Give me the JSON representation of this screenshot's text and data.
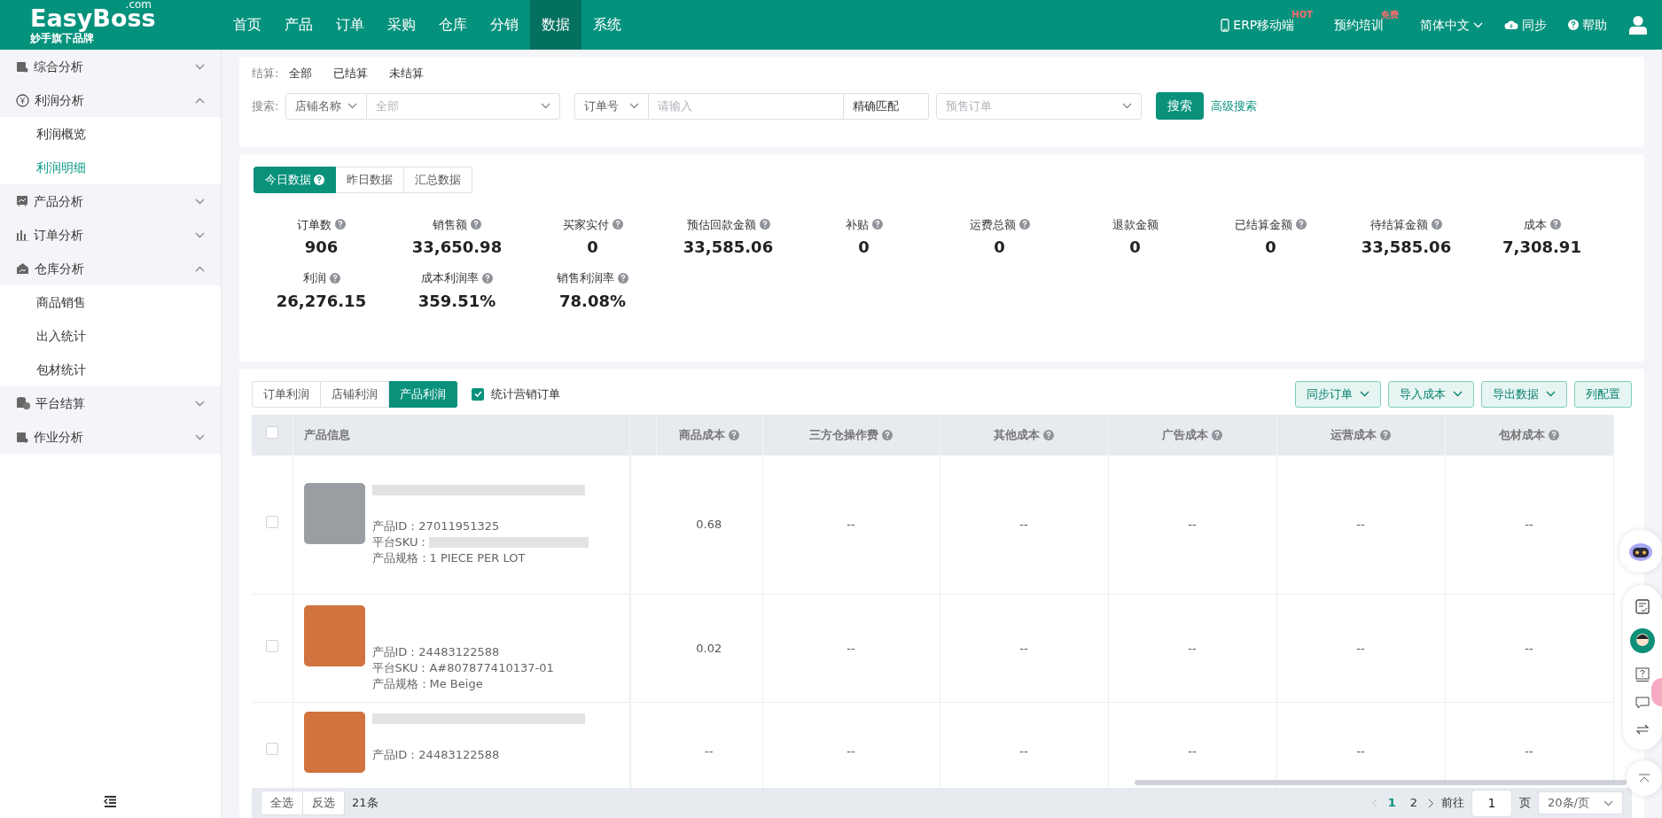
{
  "brand": {
    "name": "EasyBoss",
    "suffix": ".com",
    "tagline": "妙手旗下品牌"
  },
  "nav": [
    {
      "label": "首页",
      "selected": false
    },
    {
      "label": "产品",
      "selected": false
    },
    {
      "label": "订单",
      "selected": false
    },
    {
      "label": "采购",
      "selected": false
    },
    {
      "label": "仓库",
      "selected": false
    },
    {
      "label": "分销",
      "selected": false
    },
    {
      "label": "数据",
      "selected": true
    },
    {
      "label": "系统",
      "selected": false
    }
  ],
  "header_links": [
    {
      "kind": "mobile",
      "label": "ERP移动端",
      "tag": "HOT"
    },
    {
      "kind": "plain",
      "label": "预约培训",
      "tag": "免费"
    },
    {
      "kind": "dropdown",
      "label": "简体中文"
    },
    {
      "kind": "sync",
      "label": "同步"
    },
    {
      "kind": "help",
      "label": "帮助"
    },
    {
      "kind": "user"
    }
  ],
  "sidebar": [
    {
      "label": "综合分析",
      "expanded": false
    },
    {
      "label": "利润分析",
      "expanded": true,
      "children": [
        {
          "label": "利润概览",
          "selected": false
        },
        {
          "label": "利润明细",
          "selected": true
        }
      ]
    },
    {
      "label": "产品分析",
      "expanded": false
    },
    {
      "label": "订单分析",
      "expanded": false
    },
    {
      "label": "仓库分析",
      "expanded": true,
      "children": [
        {
          "label": "商品销售",
          "selected": false
        },
        {
          "label": "出入统计",
          "selected": false
        },
        {
          "label": "包材统计",
          "selected": false
        }
      ]
    },
    {
      "label": "平台结算",
      "expanded": false
    },
    {
      "label": "作业分析",
      "expanded": false
    }
  ],
  "filters": {
    "settle_label": "结算:",
    "settle_options": [
      "全部",
      "已结算",
      "未结算"
    ],
    "search_label": "搜索:",
    "shop_select": "店铺名称",
    "shop_value": {
      "placeholder": "全部"
    },
    "order_select": "订单号",
    "order_input": {
      "placeholder": "请输入"
    },
    "match_mode": "精确匹配",
    "presale": {
      "placeholder": "预售订单"
    },
    "search_button": "搜索",
    "advanced_link": "高级搜索"
  },
  "stat_tabs": [
    {
      "label": "今日数据",
      "selected": true,
      "help": true
    },
    {
      "label": "昨日数据",
      "selected": false,
      "help": false
    },
    {
      "label": "汇总数据",
      "selected": false,
      "help": false
    }
  ],
  "metrics": [
    {
      "label": "订单数",
      "value": "906",
      "help": true
    },
    {
      "label": "销售额",
      "value": "33,650.98",
      "help": true
    },
    {
      "label": "买家实付",
      "value": "0",
      "help": true
    },
    {
      "label": "预估回款金额",
      "value": "33,585.06",
      "help": true
    },
    {
      "label": "补贴",
      "value": "0",
      "help": true
    },
    {
      "label": "运费总额",
      "value": "0",
      "help": true
    },
    {
      "label": "退款金额",
      "value": "0",
      "help": false
    },
    {
      "label": "已结算金额",
      "value": "0",
      "help": true
    },
    {
      "label": "待结算金额",
      "value": "33,585.06",
      "help": true
    },
    {
      "label": "成本",
      "value": "7,308.91",
      "help": true
    },
    {
      "label": "利润",
      "value": "26,276.15",
      "help": true
    },
    {
      "label": "成本利润率",
      "value": "359.51%",
      "help": true
    },
    {
      "label": "销售利润率",
      "value": "78.08%",
      "help": true
    }
  ],
  "table_tabs": [
    {
      "label": "订单利润",
      "selected": false
    },
    {
      "label": "店铺利润",
      "selected": false
    },
    {
      "label": "产品利润",
      "selected": true
    }
  ],
  "marketing_orders": {
    "label": "统计营销订单",
    "checked": true
  },
  "actions": [
    {
      "label": "同步订单",
      "dropdown": true
    },
    {
      "label": "导入成本",
      "dropdown": true
    },
    {
      "label": "导出数据",
      "dropdown": true
    },
    {
      "label": "列配置",
      "dropdown": false
    }
  ],
  "header_checkbox": {
    "checked": false
  },
  "columns": [
    {
      "label": "产品信息",
      "help": false
    },
    {
      "label": "商品成本",
      "help": true
    },
    {
      "label": "三方仓操作费",
      "help": true
    },
    {
      "label": "其他成本",
      "help": true
    },
    {
      "label": "广告成本",
      "help": true
    },
    {
      "label": "运营成本",
      "help": true
    },
    {
      "label": "包材成本",
      "help": true
    }
  ],
  "rows": [
    {
      "checked": false,
      "title_redacted": true,
      "product_id": "产品ID：27011951325",
      "sku_label": "平台SKU：",
      "sku_redacted": true,
      "spec": "产品规格：1 PIECE PER LOT",
      "costs": [
        "0.68",
        "--",
        "--",
        "--",
        "--",
        "--"
      ]
    },
    {
      "checked": false,
      "title_redacted": false,
      "product_id": "产品ID：24483122588",
      "sku_label": "平台SKU：",
      "sku": "A#807877410137-01",
      "sku_redacted": false,
      "spec": "产品规格：Me Beige",
      "costs": [
        "0.02",
        "--",
        "--",
        "--",
        "--",
        "--"
      ]
    },
    {
      "checked": false,
      "title_redacted": true,
      "product_id": "产品ID：24483122588",
      "costs": [
        "--",
        "--",
        "--",
        "--",
        "--",
        "--"
      ]
    }
  ],
  "footer": {
    "select_all": "全选",
    "invert": "反选",
    "count": "21条"
  },
  "pagination": {
    "pages": [
      {
        "label": "1",
        "selected": true
      },
      {
        "label": "2",
        "selected": false
      }
    ],
    "goto": "前往",
    "page_value": "1",
    "page_unit": "页",
    "page_size": "20条/页"
  }
}
